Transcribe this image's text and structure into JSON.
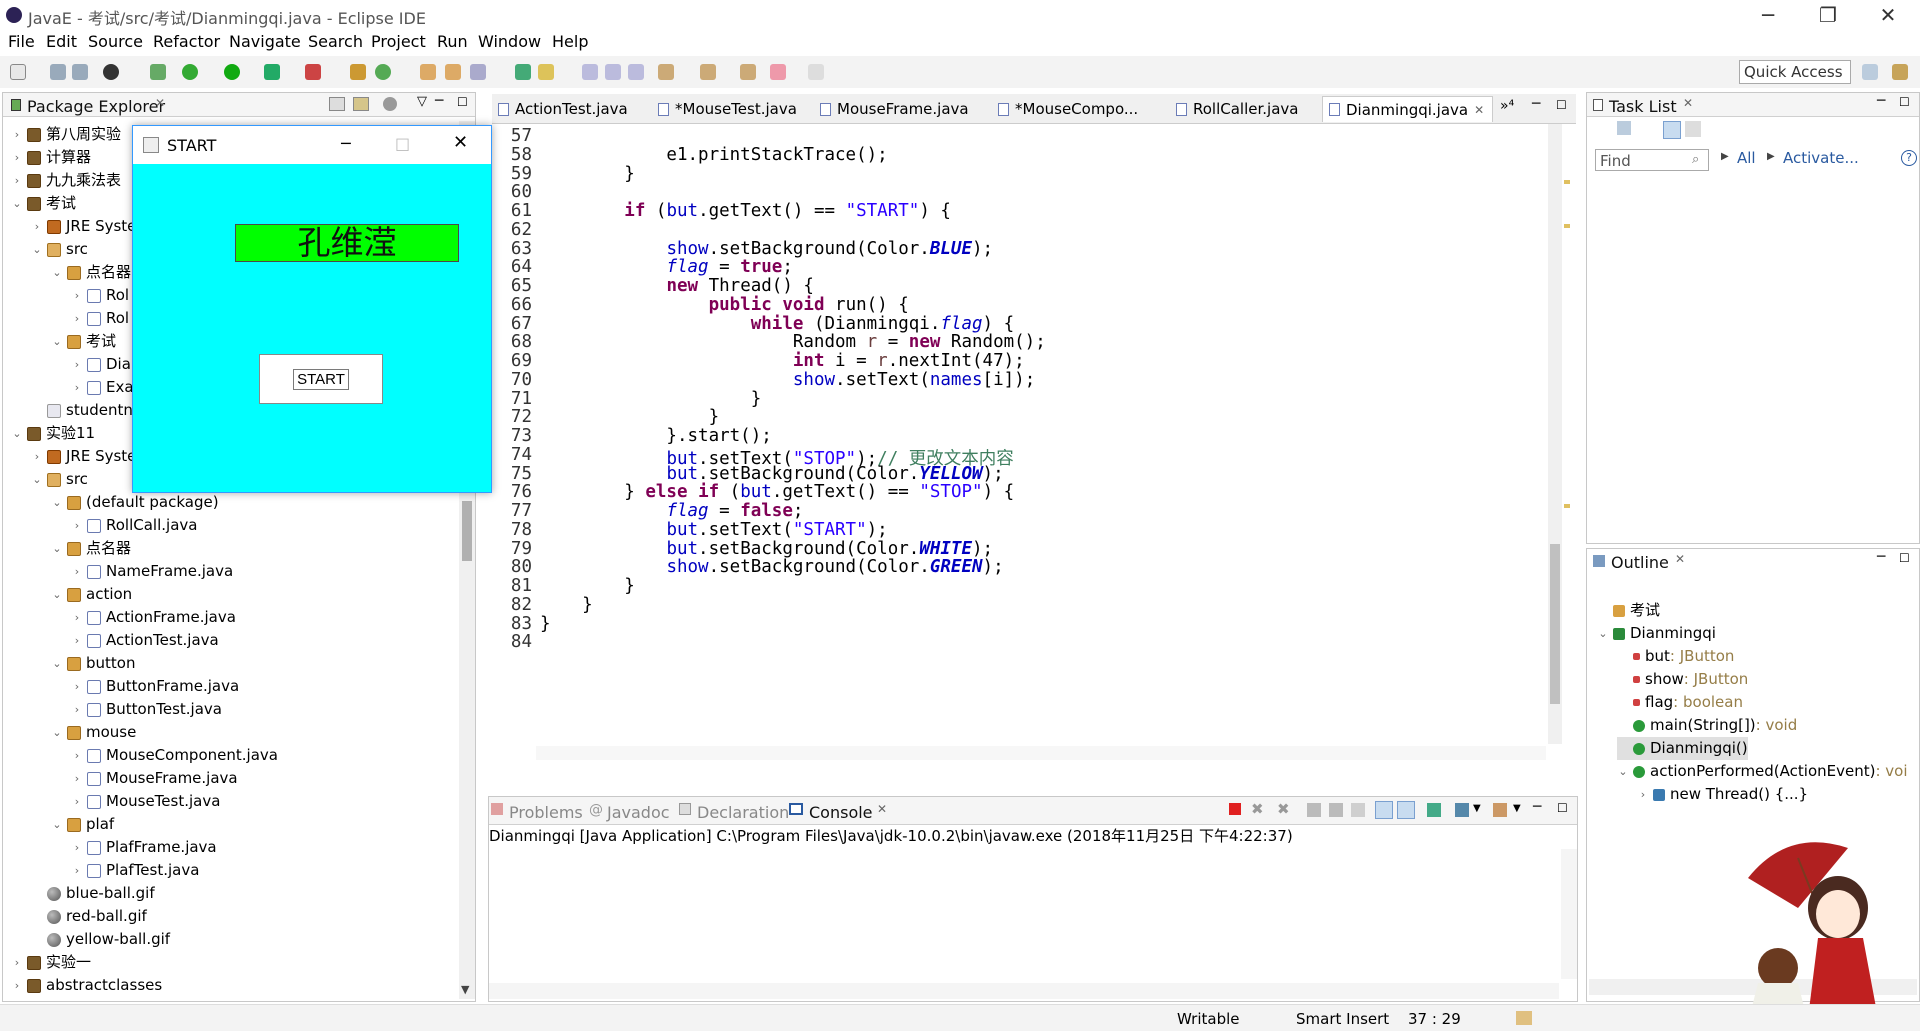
{
  "window": {
    "title": "JavaE - 考试/src/考试/Dianmingqi.java - Eclipse IDE",
    "minimize": "─",
    "maximize": "❐",
    "close": "✕"
  },
  "menu": [
    "File",
    "Edit",
    "Source",
    "Refactor",
    "Navigate",
    "Search",
    "Project",
    "Run",
    "Window",
    "Help"
  ],
  "toolbar": {
    "quick_access": "Quick Access"
  },
  "package_explorer": {
    "title": "Package Explorer",
    "items": [
      {
        "label": "第八周实验",
        "kind": "proj"
      },
      {
        "label": "计算器",
        "kind": "proj"
      },
      {
        "label": "九九乘法表",
        "kind": "proj"
      },
      {
        "label": "考试",
        "kind": "proj"
      },
      {
        "label": "JRE Syste",
        "kind": "lib"
      },
      {
        "label": "src",
        "kind": "src"
      },
      {
        "label": "点名器",
        "kind": "pkg"
      },
      {
        "label": "Rol",
        "kind": "jfile"
      },
      {
        "label": "Rol",
        "kind": "jfile"
      },
      {
        "label": "考试",
        "kind": "pkg"
      },
      {
        "label": "Dia",
        "kind": "jfile"
      },
      {
        "label": "Exa",
        "kind": "jfile"
      },
      {
        "label": "studentn",
        "kind": "ftxt"
      },
      {
        "label": "实验11",
        "kind": "proj"
      },
      {
        "label": "JRE Syste",
        "kind": "lib"
      },
      {
        "label": "src",
        "kind": "src"
      },
      {
        "label": "(default package)",
        "kind": "pkg"
      },
      {
        "label": "RollCall.java",
        "kind": "jfile"
      },
      {
        "label": "点名器",
        "kind": "pkg"
      },
      {
        "label": "NameFrame.java",
        "kind": "jfile"
      },
      {
        "label": "action",
        "kind": "pkg"
      },
      {
        "label": "ActionFrame.java",
        "kind": "jfile"
      },
      {
        "label": "ActionTest.java",
        "kind": "jfile"
      },
      {
        "label": "button",
        "kind": "pkg"
      },
      {
        "label": "ButtonFrame.java",
        "kind": "jfile"
      },
      {
        "label": "ButtonTest.java",
        "kind": "jfile"
      },
      {
        "label": "mouse",
        "kind": "pkg"
      },
      {
        "label": "MouseComponent.java",
        "kind": "jfile"
      },
      {
        "label": "MouseFrame.java",
        "kind": "jfile"
      },
      {
        "label": "MouseTest.java",
        "kind": "jfile"
      },
      {
        "label": "plaf",
        "kind": "pkg"
      },
      {
        "label": "PlafFrame.java",
        "kind": "jfile"
      },
      {
        "label": "PlafTest.java",
        "kind": "jfile"
      },
      {
        "label": "blue-ball.gif",
        "kind": "ball"
      },
      {
        "label": "red-ball.gif",
        "kind": "ball"
      },
      {
        "label": "yellow-ball.gif",
        "kind": "ball"
      },
      {
        "label": "实验一",
        "kind": "proj"
      },
      {
        "label": "abstractclasses",
        "kind": "proj"
      }
    ]
  },
  "editor_tabs": [
    {
      "label": "ActionTest.java"
    },
    {
      "label": "*MouseTest.java"
    },
    {
      "label": "MouseFrame.java"
    },
    {
      "label": "*MouseCompo..."
    },
    {
      "label": "RollCaller.java"
    },
    {
      "label": "Dianmingqi.java",
      "active": true
    }
  ],
  "editor_overflow": "»⁴",
  "code": {
    "line_numbers": [
      "57",
      "58",
      "59",
      "60",
      "61",
      "62",
      "63",
      "64",
      "65",
      "66",
      "67",
      "68",
      "69",
      "70",
      "71",
      "72",
      "73",
      "74",
      "75",
      "76",
      "77",
      "78",
      "79",
      "80",
      "81",
      "82",
      "83",
      "84"
    ],
    "lines": [
      "",
      "            e1.printStackTrace();",
      "        }",
      "",
      "        if (but.getText() == \"START\") {",
      "",
      "            show.setBackground(Color.BLUE);",
      "            flag = true;",
      "            new Thread() {",
      "                public void run() {",
      "                    while (Dianmingqi.flag) {",
      "                        Random r = new Random();",
      "                        int i = r.nextInt(47);",
      "                        show.setText(names[i]);",
      "                    }",
      "                }",
      "            }.start();",
      "            but.setText(\"STOP\");// 更改文本内容",
      "            but.setBackground(Color.YELLOW);",
      "        } else if (but.getText() == \"STOP\") {",
      "            flag = false;",
      "            but.setText(\"START\");",
      "            but.setBackground(Color.WHITE);",
      "            show.setBackground(Color.GREEN);",
      "        }",
      "    }",
      "}",
      ""
    ]
  },
  "console": {
    "tabs": [
      "Problems",
      "Javadoc",
      "Declaration",
      "Console"
    ],
    "active_tab": "Console",
    "launch": "Dianmingqi [Java Application] C:\\Program Files\\Java\\jdk-10.0.2\\bin\\javaw.exe (2018年11月25日 下午4:22:37)"
  },
  "task_list": {
    "title": "Task List",
    "find_placeholder": "Find",
    "all": "All",
    "activate": "Activate..."
  },
  "outline": {
    "title": "Outline",
    "items": [
      {
        "label": "考试",
        "indent": 0
      },
      {
        "label": "Dianmingqi",
        "indent": 0
      },
      {
        "label": "but",
        "type": " : JButton",
        "indent": 1
      },
      {
        "label": "show",
        "type": " : JButton",
        "indent": 1
      },
      {
        "label": "flag",
        "type": " : boolean",
        "indent": 1
      },
      {
        "label": "main(String[])",
        "type": " : void",
        "indent": 1
      },
      {
        "label": "Dianmingqi()",
        "type": "",
        "indent": 1,
        "selected": true
      },
      {
        "label": "actionPerformed(ActionEvent)",
        "type": " : voi",
        "indent": 1
      },
      {
        "label": "new Thread() {...}",
        "type": "",
        "indent": 2
      }
    ]
  },
  "statusbar": {
    "writable": "Writable",
    "insert": "Smart Insert",
    "position": "37 : 29"
  },
  "start_window": {
    "title": "START",
    "name_label": "孔维滢",
    "button": "START",
    "minimize": "─",
    "maximize": "□",
    "close": "✕"
  },
  "colors": {
    "cyan_bg": "#00ffff",
    "name_bg": "#00ff00",
    "keyword": "#7f0055",
    "string": "#2a00ff",
    "field": "#0000c0"
  }
}
